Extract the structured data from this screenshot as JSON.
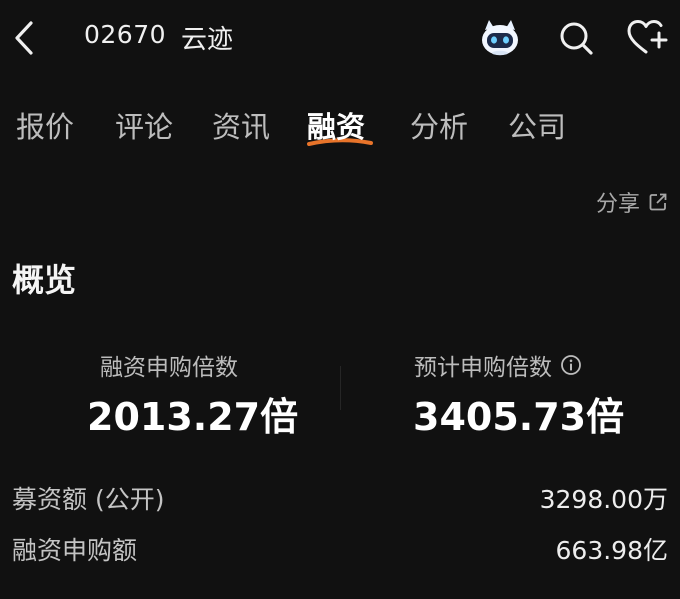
{
  "header": {
    "stock_code": "02670",
    "stock_name": "云迹",
    "icons": [
      "back-icon",
      "robot-mascot-icon",
      "search-icon",
      "heart-plus-icon"
    ]
  },
  "tabs": [
    {
      "label": "报价"
    },
    {
      "label": "评论"
    },
    {
      "label": "资讯"
    },
    {
      "label": "融资"
    },
    {
      "label": "分析"
    },
    {
      "label": "公司"
    }
  ],
  "active_tab": "融资",
  "share_label": "分享",
  "overview": {
    "title": "概览",
    "stats": [
      {
        "label": "融资申购倍数",
        "value": "2013.27倍"
      },
      {
        "label": "预计申购倍数",
        "value": "3405.73倍"
      }
    ],
    "rows": [
      {
        "label": "募资额 (公开)",
        "value": "3298.00万"
      },
      {
        "label": "融资申购额",
        "value": "663.98亿"
      }
    ]
  },
  "colors": {
    "background": "#111111",
    "accent_underline": "#e8742a"
  }
}
